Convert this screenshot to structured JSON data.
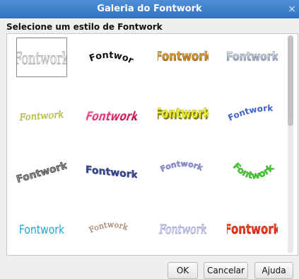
{
  "window": {
    "title": "Galeria do Fontwork",
    "close_glyph": "×"
  },
  "heading": "Selecione um estilo de Fontwork",
  "gallery": {
    "item_text": "Fontwork",
    "selected_index": 0,
    "items": [
      {
        "style": "outline-gray"
      },
      {
        "style": "arch-black"
      },
      {
        "style": "gold-gradient"
      },
      {
        "style": "silver-gradient"
      },
      {
        "style": "yellow-green-italic"
      },
      {
        "style": "red-perspective"
      },
      {
        "style": "yellow-3d"
      },
      {
        "style": "blue-wave"
      },
      {
        "style": "gray-rotated"
      },
      {
        "style": "blue-slanted"
      },
      {
        "style": "purple-circle"
      },
      {
        "style": "green-arc"
      },
      {
        "style": "blue-plain"
      },
      {
        "style": "brown-curve"
      },
      {
        "style": "lavender-italic"
      },
      {
        "style": "red-orange"
      }
    ]
  },
  "buttons": {
    "ok": "OK",
    "cancel": "Cancelar",
    "help": "Ajuda"
  }
}
